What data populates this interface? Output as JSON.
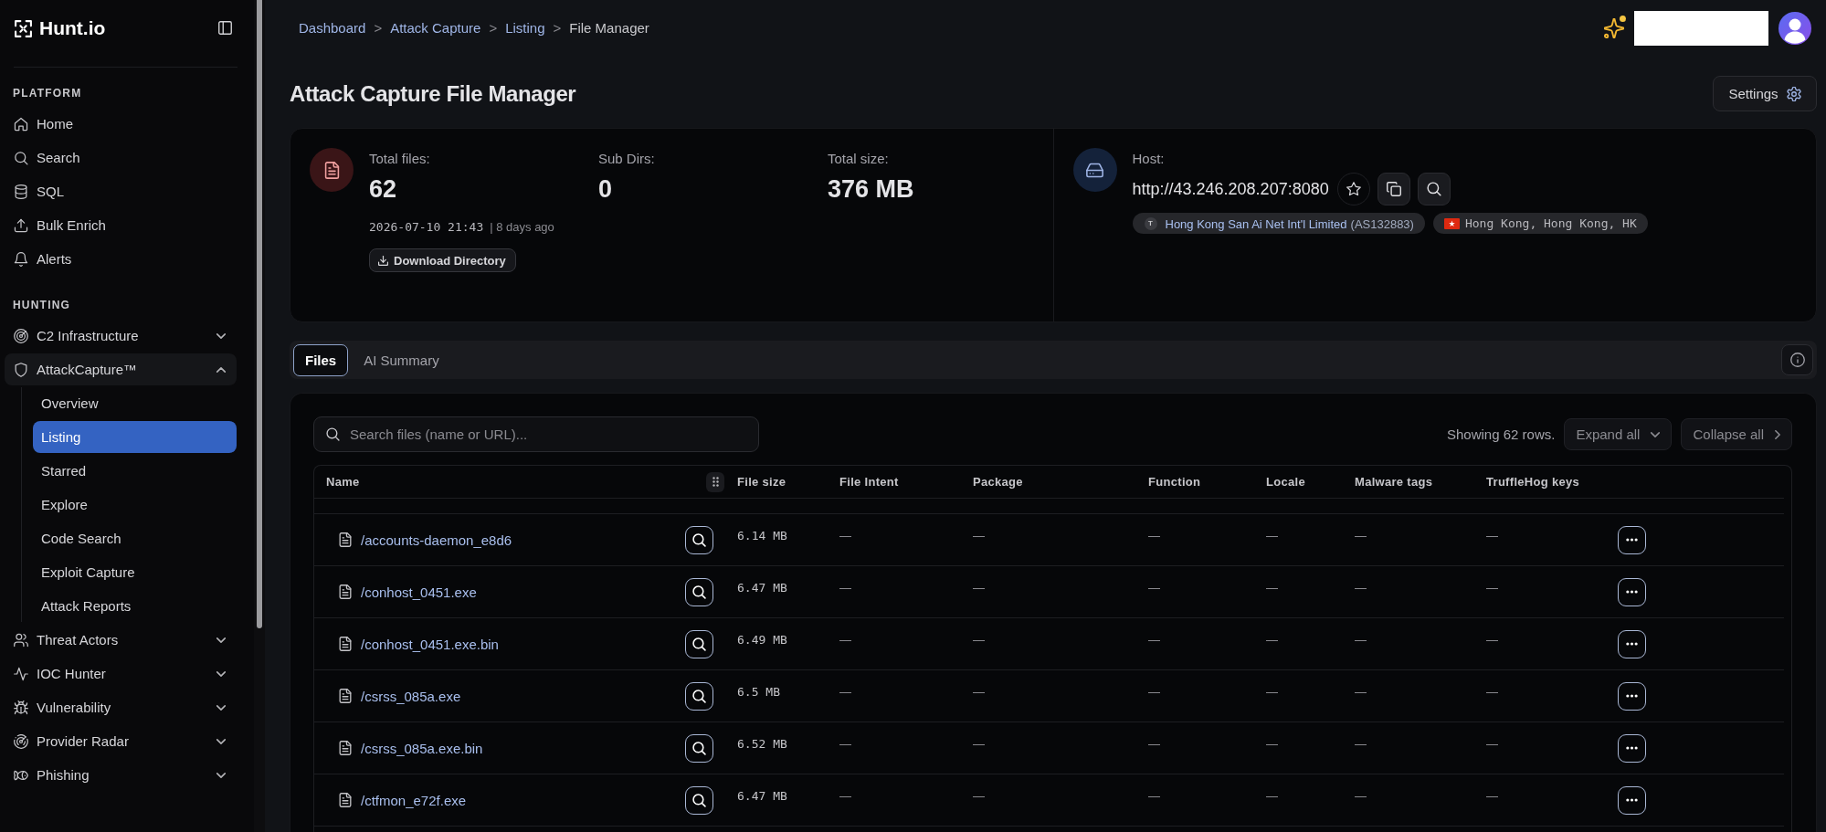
{
  "sidebar": {
    "logo": "Hunt.io",
    "sections": [
      {
        "title": "PLATFORM",
        "items": [
          {
            "label": "Home",
            "selected": false
          },
          {
            "label": "Search",
            "selected": false
          },
          {
            "label": "SQL",
            "selected": false
          },
          {
            "label": "Bulk Enrich",
            "selected": false
          },
          {
            "label": "Alerts",
            "selected": false
          }
        ]
      },
      {
        "title": "HUNTING",
        "items": [
          {
            "label": "C2 Infrastructure",
            "selected": false,
            "expanded": false
          },
          {
            "label": "AttackCapture™",
            "selected": true,
            "expanded": true,
            "children": [
              {
                "label": "Overview",
                "selected": false
              },
              {
                "label": "Listing",
                "selected": true
              },
              {
                "label": "Starred",
                "selected": false
              },
              {
                "label": "Explore",
                "selected": false
              },
              {
                "label": "Code Search",
                "selected": false
              },
              {
                "label": "Exploit Capture",
                "selected": false
              },
              {
                "label": "Attack Reports",
                "selected": false
              }
            ]
          },
          {
            "label": "Threat Actors",
            "selected": false,
            "expanded": false
          },
          {
            "label": "IOC Hunter",
            "selected": false,
            "expanded": false
          },
          {
            "label": "Vulnerability",
            "selected": false,
            "expanded": false
          },
          {
            "label": "Provider Radar",
            "selected": false,
            "expanded": false
          },
          {
            "label": "Phishing",
            "selected": false,
            "expanded": false
          }
        ]
      }
    ]
  },
  "header": {
    "breadcrumb": [
      {
        "label": "Dashboard",
        "link": true,
        "separator": ">"
      },
      {
        "label": "Attack Capture",
        "link": true,
        "separator": ">"
      },
      {
        "label": "Listing",
        "link": true,
        "separator": ">"
      },
      {
        "label": "File Manager",
        "link": false
      }
    ],
    "notification": true
  },
  "page": {
    "title": "Attack Capture File Manager",
    "settings_button": "Settings"
  },
  "summary": {
    "stats": [
      {
        "label": "Total files:",
        "value": "62"
      },
      {
        "label": "Sub Dirs:",
        "value": "0"
      },
      {
        "label": "Total size:",
        "value": "376 MB"
      }
    ],
    "timestamp": "2026-07-10 21:43",
    "age": "| 8 days ago",
    "download_button": "Download Directory"
  },
  "host": {
    "label": "Host:",
    "url": "http://43.246.208.207:8080",
    "starred": false,
    "provider_initial": "T",
    "provider_name": "Hong Kong San Ai Net Int'l Limited",
    "provider_asn": "(AS132883)",
    "location": "Hong Kong, Hong Kong, HK"
  },
  "tabs": [
    {
      "label": "Files",
      "selected": true
    },
    {
      "label": "AI Summary",
      "selected": false
    }
  ],
  "files": {
    "search_placeholder": "Search files (name or URL)...",
    "row_count": "Showing 62 rows.",
    "expand_button": "Expand all",
    "collapse_button": "Collapse all",
    "table": {
      "columns": [
        {
          "label": "Name",
          "kind": "file"
        },
        {
          "label": "File size",
          "kind": "size"
        },
        {
          "label": "File Intent",
          "kind": "text"
        },
        {
          "label": "Package",
          "kind": "text"
        },
        {
          "label": "Function",
          "kind": "text"
        },
        {
          "label": "Locale",
          "kind": "text"
        },
        {
          "label": "Malware tags",
          "kind": "text"
        },
        {
          "label": "TruffleHog keys",
          "kind": "text"
        }
      ],
      "rows": [
        {
          "cells": [
            "/accounts-daemon_e8d6",
            "6.14 MB",
            "—",
            "—",
            "—",
            "—",
            "—",
            "—"
          ]
        },
        {
          "cells": [
            "/conhost_0451.exe",
            "6.47 MB",
            "—",
            "—",
            "—",
            "—",
            "—",
            "—"
          ]
        },
        {
          "cells": [
            "/conhost_0451.exe.bin",
            "6.49 MB",
            "—",
            "—",
            "—",
            "—",
            "—",
            "—"
          ]
        },
        {
          "cells": [
            "/csrss_085a.exe",
            "6.5 MB",
            "—",
            "—",
            "—",
            "—",
            "—",
            "—"
          ]
        },
        {
          "cells": [
            "/csrss_085a.exe.bin",
            "6.52 MB",
            "—",
            "—",
            "—",
            "—",
            "—",
            "—"
          ]
        },
        {
          "cells": [
            "/ctfmon_e72f.exe",
            "6.47 MB",
            "—",
            "—",
            "—",
            "—",
            "—",
            "—"
          ]
        }
      ]
    }
  }
}
